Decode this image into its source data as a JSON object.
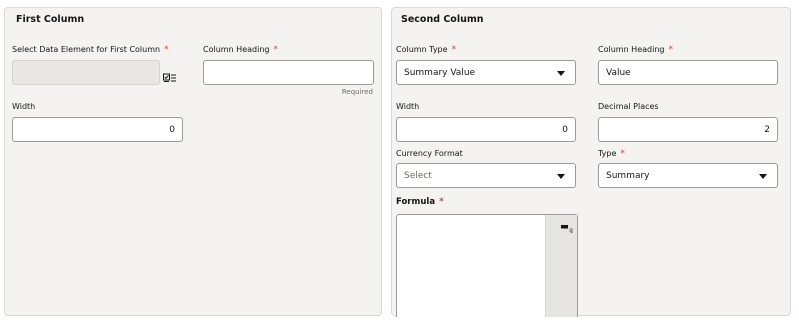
{
  "first_column": {
    "title": "First Column",
    "select_element_label": "Select Data Element for First Column",
    "select_element_value": "",
    "select_element_icon": "select-list-icon",
    "heading_label": "Column Heading",
    "heading_value": "",
    "heading_helper": "Required",
    "width_label": "Width",
    "width_value": "0"
  },
  "second_column": {
    "title": "Second Column",
    "column_type_label": "Column Type",
    "column_type_value": "Summary Value",
    "heading_label": "Column Heading",
    "heading_value": "Value",
    "width_label": "Width",
    "width_value": "0",
    "decimal_label": "Decimal Places",
    "decimal_value": "2",
    "currency_label": "Currency Format",
    "currency_placeholder": "Select",
    "type_label": "Type",
    "type_value": "Summary",
    "formula_label": "Formula",
    "formula_value": "",
    "formula_icon": "expand-editor-icon"
  },
  "required_marker": "*",
  "colors": {
    "panel_bg": "#f4f3f1",
    "required": "#c74634",
    "border": "#9e9a95"
  }
}
